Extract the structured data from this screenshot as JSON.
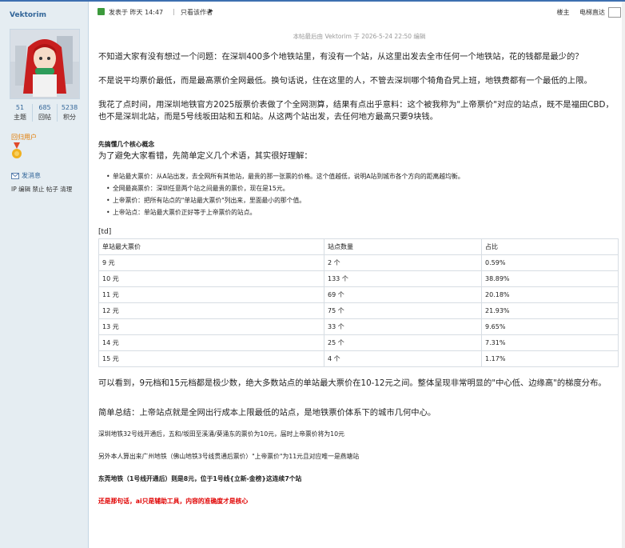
{
  "user": {
    "name": "Vektorim",
    "stats": [
      {
        "value": "51",
        "label": "主题"
      },
      {
        "value": "685",
        "label": "回帖"
      },
      {
        "value": "5238",
        "label": "积分"
      }
    ],
    "group": "回归用户",
    "pm_label": "发消息",
    "admin_links": "IP 编辑 禁止 帖子 清理"
  },
  "post": {
    "meta": "发表于 昨天 14:47",
    "author_only": "只看该作者",
    "floor": "楼主",
    "direct_link": "电梯直达",
    "edit_note": "本帖最后由 Vektorim 于 2026-5-24 22:50 编辑",
    "paragraphs": [
      "不知道大家有没有想过一个问题：在深圳400多个地铁站里，有没有一个站，从这里出发去全市任何一个地铁站，花的钱都是最少的？",
      "不是说平均票价最低，而是最高票价全网最低。换句话说，住在这里的人，不管去深圳哪个犄角旮旯上班，地铁费都有一个最低的上限。",
      "我花了点时间，用深圳地铁官方2025版票价表做了个全网测算，结果有点出乎意料：这个被我称为\"上帝票价\"对应的站点，既不是福田CBD，也不是深圳北站，而是5号线坂田站和五和站。从这两个站出发，去任何地方最高只要9块钱。"
    ],
    "concept_title": "先搞懂几个核心概念",
    "concept_intro": "为了避免大家看错，先简单定义几个术语，其实很好理解：",
    "terms": [
      "单站最大票价：从A站出发，去全网所有其他站，最贵的那一张票的价格。这个值越低，说明A站到城市各个方向的距离越均衡。",
      "全网最高票价：深圳任意两个站之间最贵的票价，现在是15元。",
      "上帝票价：把所有站点的\"单站最大票价\"列出来，里面最小的那个值。",
      "上帝站点：单站最大票价正好等于上帝票价的站点。"
    ],
    "td_tag": "[td]",
    "table": {
      "headers": [
        "单站最大票价",
        "站点数量",
        "占比"
      ],
      "rows": [
        [
          "9 元",
          "2 个",
          "0.59%"
        ],
        [
          "10 元",
          "133 个",
          "38.89%"
        ],
        [
          "11 元",
          "69 个",
          "20.18%"
        ],
        [
          "12 元",
          "75 个",
          "21.93%"
        ],
        [
          "13 元",
          "33 个",
          "9.65%"
        ],
        [
          "14 元",
          "25 个",
          "7.31%"
        ],
        [
          "15 元",
          "4 个",
          "1.17%"
        ]
      ]
    },
    "analysis": "可以看到，9元档和15元档都是极少数，绝大多数站点的单站最大票价在10-12元之间。整体呈现非常明显的\"中心低、边缘高\"的梯度分布。",
    "summary": "简单总结：上帝站点就是全网出行成本上限最低的站点，是地铁票价体系下的城市几何中心。",
    "note1": "深圳地铁32号线开通后，五和/坂田至溪涌/葵涌东的票价为10元，届时上帝票价将为10元",
    "note2": "另外本人算出来广州地铁（佛山地铁3号线贯通后票价）\"上帝票价\"为11元且对应唯一是燕塘站",
    "note3": "东莞地铁（1号线开通后）则是8元，位于1号线{立新-金榜}这连续7个站",
    "note4": "还是那句话，ai只是辅助工具，内容的准确度才是核心"
  }
}
